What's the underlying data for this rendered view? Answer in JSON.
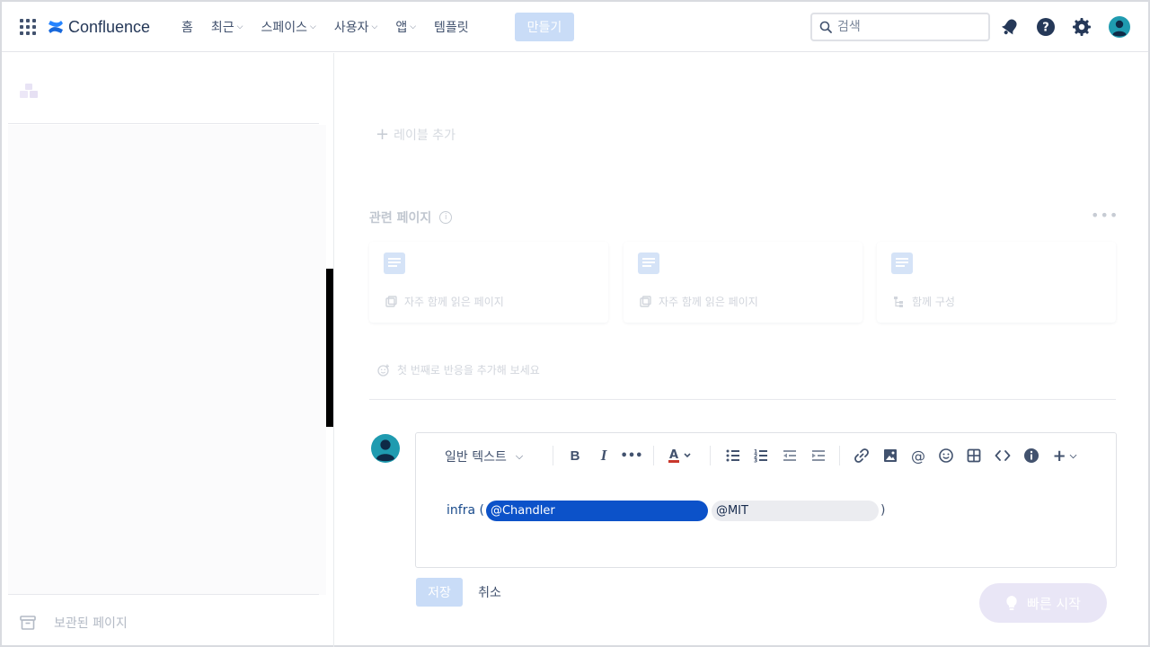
{
  "nav": {
    "brand": "Confluence",
    "items": [
      {
        "label": "홈",
        "dropdown": false
      },
      {
        "label": "최근",
        "dropdown": true
      },
      {
        "label": "스페이스",
        "dropdown": true
      },
      {
        "label": "사용자",
        "dropdown": true
      },
      {
        "label": "앱",
        "dropdown": true
      },
      {
        "label": "템플릿",
        "dropdown": false
      }
    ],
    "create_label": "만들기",
    "search_placeholder": "검색"
  },
  "sidebar": {
    "archived_label": "보관된 페이지"
  },
  "main": {
    "add_label": "레이블 추가",
    "related_title": "관련 페이지",
    "cards": [
      {
        "subtitle": "자주 함께 읽은 페이지",
        "icon": "pages-icon"
      },
      {
        "subtitle": "자주 함께 읽은 페이지",
        "icon": "pages-icon"
      },
      {
        "subtitle": "함께 구성",
        "icon": "hierarchy-icon"
      }
    ],
    "reaction_prompt": "첫 번째로 반응을 추가해 보세요"
  },
  "editor": {
    "text_style": "일반 텍스트",
    "content_prefix": "infra (",
    "mentions": [
      {
        "label": "@Chandler",
        "active": true
      },
      {
        "label": "@MIT",
        "active": false
      }
    ],
    "content_suffix": ")",
    "save_label": "저장",
    "cancel_label": "취소"
  },
  "quickstart_label": "빠른 시작",
  "colors": {
    "brand_blue": "#0c52c9",
    "disabled_blue": "#c9dcf7",
    "text_primary": "#172b4d",
    "text_secondary": "#42526e"
  }
}
